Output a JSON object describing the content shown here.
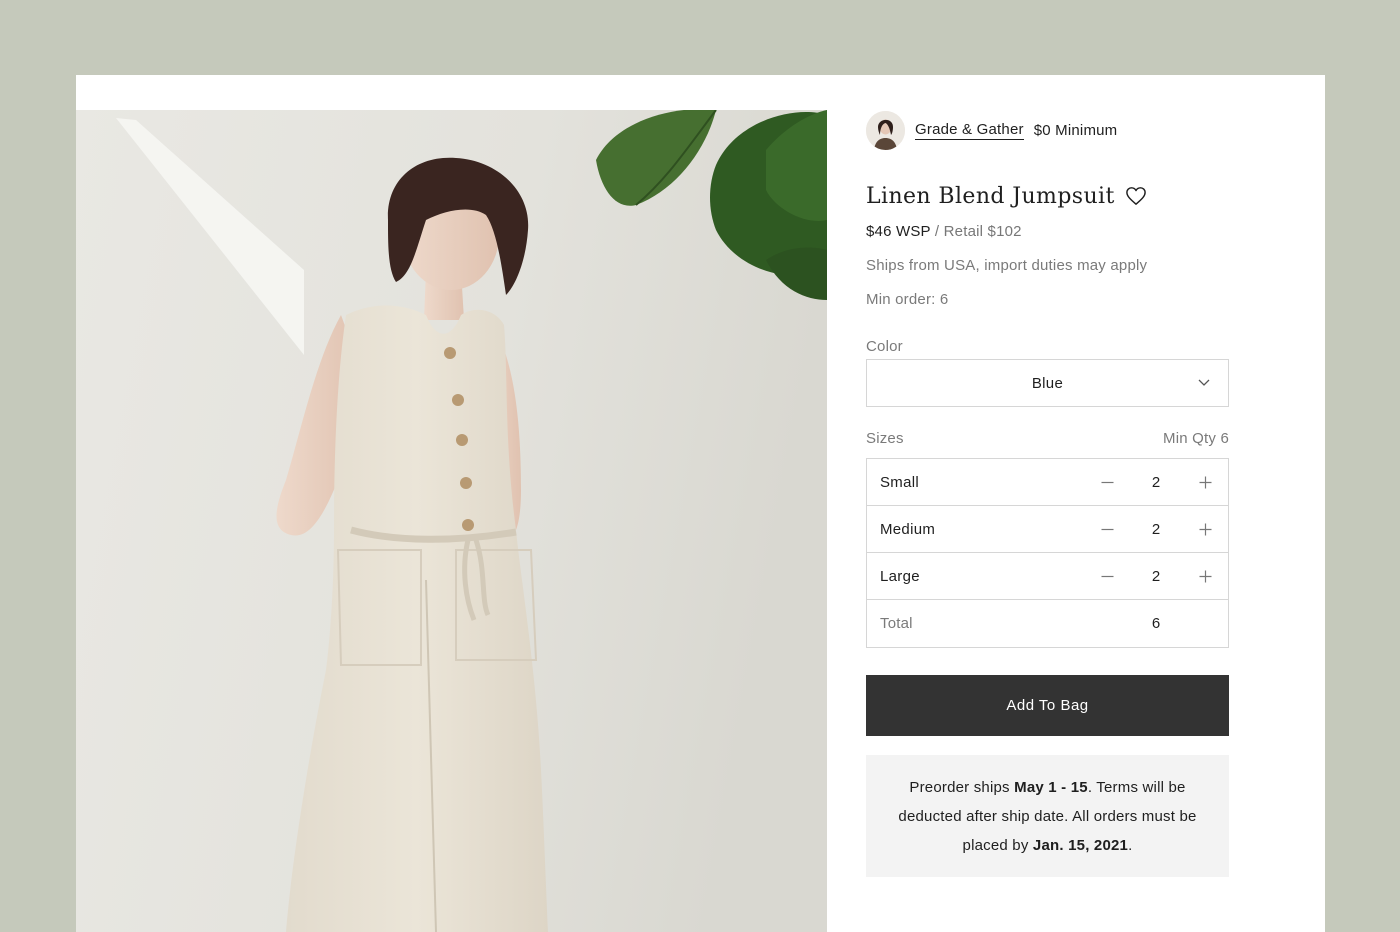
{
  "brand": {
    "name": "Grade & Gather",
    "minimum": "$0 Minimum"
  },
  "product": {
    "title": "Linen Blend Jumpsuit",
    "price_wsp": "$46 WSP",
    "price_separator": "/",
    "price_retail": "Retail $102",
    "shipping_note": "Ships from USA, import duties may apply",
    "min_order": "Min order: 6"
  },
  "color": {
    "label": "Color",
    "selected": "Blue"
  },
  "sizes": {
    "label": "Sizes",
    "min_qty": "Min Qty 6",
    "rows": [
      {
        "name": "Small",
        "qty": "2"
      },
      {
        "name": "Medium",
        "qty": "2"
      },
      {
        "name": "Large",
        "qty": "2"
      }
    ],
    "total_label": "Total",
    "total_value": "6"
  },
  "actions": {
    "add_to_bag": "Add To Bag"
  },
  "notice": {
    "part1": "Preorder ships ",
    "ship_window": "May 1 - 15",
    "part2": ". Terms will be deducted after ship date. All orders must be placed by ",
    "deadline": "Jan. 15, 2021",
    "part3": "."
  },
  "icons": {
    "favorite": "heart-icon",
    "dropdown": "chevron-down-icon",
    "decrement": "minus-icon",
    "increment": "plus-icon"
  },
  "colors": {
    "page_background": "#c5c9bb",
    "card": "#ffffff",
    "button": "#333333",
    "notice_background": "#f3f3f3",
    "muted_text": "#7a7a7a"
  }
}
